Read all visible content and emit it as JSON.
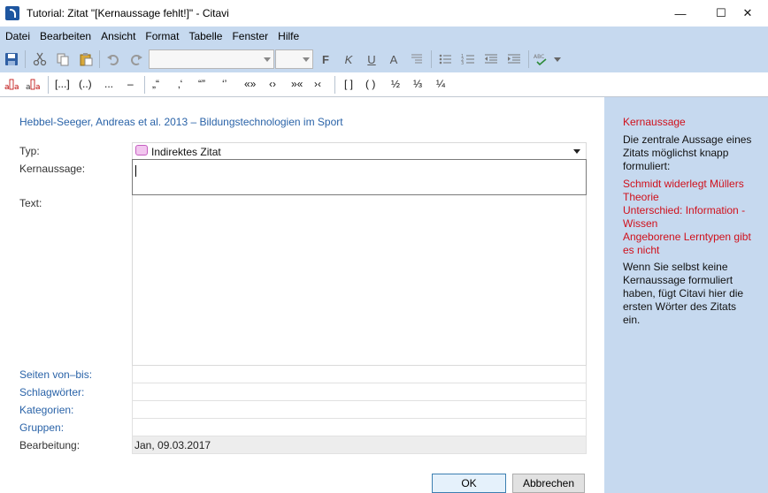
{
  "window": {
    "title": "Tutorial: Zitat \"[Kernaussage fehlt!]\" - Citavi",
    "minimize": "—",
    "maximize": "☐",
    "close": "✕"
  },
  "menu": [
    "Datei",
    "Bearbeiten",
    "Ansicht",
    "Format",
    "Tabelle",
    "Fenster",
    "Hilfe"
  ],
  "toolbar": {
    "bold": "F",
    "italic": "K",
    "underline": "U",
    "font_color": "A"
  },
  "format_bar": {
    "items": [
      "[...]",
      "(..)",
      "...",
      "–",
      "„“",
      "‚‘",
      "“”",
      "‘’",
      "«»",
      "‹›",
      "»«",
      "›‹",
      "[ ]",
      "( )",
      "½",
      "⅓",
      "¼"
    ]
  },
  "reference": "Hebbel-Seeger, Andreas et al. 2013 – Bildungstechnologien im Sport",
  "form": {
    "typ_label": "Typ:",
    "typ_value": "Indirektes Zitat",
    "kernaussage_label": "Kernaussage:",
    "text_label": "Text:",
    "seiten_label": "Seiten von–bis:",
    "schlagwoerter_label": "Schlagwörter:",
    "kategorien_label": "Kategorien:",
    "gruppen_label": "Gruppen:",
    "bearbeitung_label": "Bearbeitung:",
    "bearbeitung_value": "Jan, 09.03.2017"
  },
  "buttons": {
    "ok": "OK",
    "cancel": "Abbrechen"
  },
  "help": {
    "heading": "Kernaussage",
    "intro": "Die zentrale Aussage eines Zitats möglichst knapp formuliert:",
    "examples": [
      "Schmidt widerlegt Müllers Theorie",
      "Unterschied: Information - Wissen",
      "Angeborene Lerntypen gibt es nicht"
    ],
    "note": "Wenn Sie selbst keine Kernaussage formuliert haben, fügt Citavi hier die ersten Wörter des Zitats ein."
  }
}
